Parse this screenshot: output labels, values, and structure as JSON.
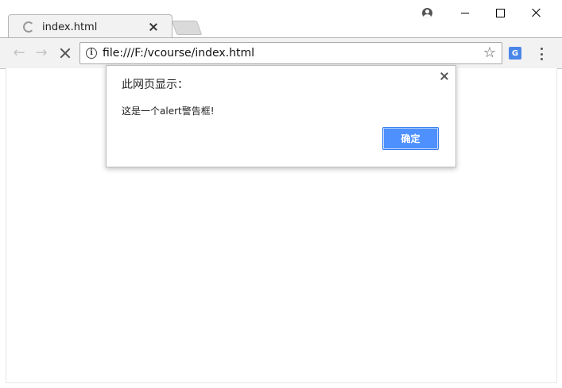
{
  "tab": {
    "title": "index.html"
  },
  "address_bar": {
    "url": "file:///F:/vcourse/index.html"
  },
  "window_controls": {
    "minimize": "–",
    "maximize": "□",
    "close": "×"
  },
  "alert_dialog": {
    "title": "此网页显示：",
    "message": "这是一个alert警告框!",
    "ok_label": "确定"
  },
  "colors": {
    "toolbar_bg": "#f2f2f2",
    "button_blue": "#4d90fe",
    "translate_blue": "#4a86e8"
  },
  "icons": {
    "tab_loading": "spinner-icon",
    "back": "back-arrow-icon",
    "forward": "forward-arrow-icon",
    "stop": "stop-icon",
    "site_info": "info-icon",
    "bookmark": "star-icon",
    "translate": "translate-icon",
    "menu": "menu-icon",
    "profile": "profile-icon"
  }
}
